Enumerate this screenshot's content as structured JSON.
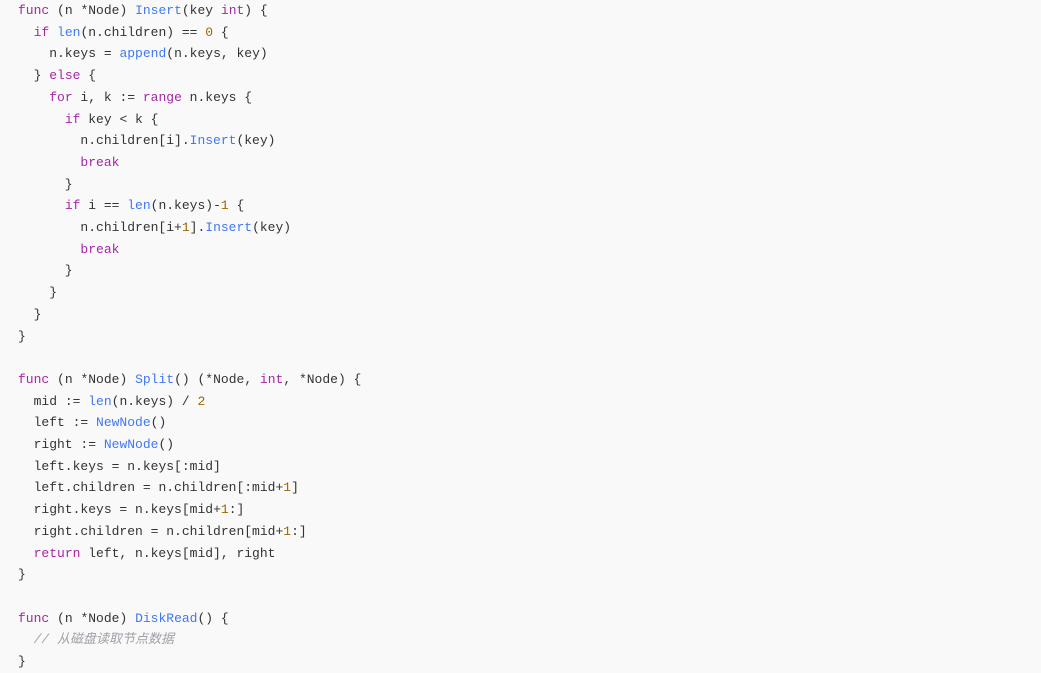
{
  "code": {
    "lines": [
      [
        {
          "t": "func",
          "c": "kw"
        },
        {
          "t": " (n ",
          "c": "ident"
        },
        {
          "t": "*",
          "c": "op"
        },
        {
          "t": "Node) ",
          "c": "ident"
        },
        {
          "t": "Insert",
          "c": "fn"
        },
        {
          "t": "(key ",
          "c": "ident"
        },
        {
          "t": "int",
          "c": "type"
        },
        {
          "t": ") {",
          "c": "punct"
        }
      ],
      [
        {
          "t": "  ",
          "c": "ident"
        },
        {
          "t": "if",
          "c": "kw"
        },
        {
          "t": " ",
          "c": "ident"
        },
        {
          "t": "len",
          "c": "call"
        },
        {
          "t": "(n.children) ",
          "c": "ident"
        },
        {
          "t": "==",
          "c": "op"
        },
        {
          "t": " ",
          "c": "ident"
        },
        {
          "t": "0",
          "c": "num"
        },
        {
          "t": " {",
          "c": "punct"
        }
      ],
      [
        {
          "t": "    n.keys ",
          "c": "ident"
        },
        {
          "t": "=",
          "c": "op"
        },
        {
          "t": " ",
          "c": "ident"
        },
        {
          "t": "append",
          "c": "call"
        },
        {
          "t": "(n.keys, key)",
          "c": "ident"
        }
      ],
      [
        {
          "t": "  } ",
          "c": "punct"
        },
        {
          "t": "else",
          "c": "kw"
        },
        {
          "t": " {",
          "c": "punct"
        }
      ],
      [
        {
          "t": "    ",
          "c": "ident"
        },
        {
          "t": "for",
          "c": "kw"
        },
        {
          "t": " i, k ",
          "c": "ident"
        },
        {
          "t": ":=",
          "c": "op"
        },
        {
          "t": " ",
          "c": "ident"
        },
        {
          "t": "range",
          "c": "kw"
        },
        {
          "t": " n.keys {",
          "c": "ident"
        }
      ],
      [
        {
          "t": "      ",
          "c": "ident"
        },
        {
          "t": "if",
          "c": "kw"
        },
        {
          "t": " key ",
          "c": "ident"
        },
        {
          "t": "<",
          "c": "op"
        },
        {
          "t": " k {",
          "c": "ident"
        }
      ],
      [
        {
          "t": "        n.children[i].",
          "c": "ident"
        },
        {
          "t": "Insert",
          "c": "call"
        },
        {
          "t": "(key)",
          "c": "ident"
        }
      ],
      [
        {
          "t": "        ",
          "c": "ident"
        },
        {
          "t": "break",
          "c": "kw"
        }
      ],
      [
        {
          "t": "      }",
          "c": "punct"
        }
      ],
      [
        {
          "t": "      ",
          "c": "ident"
        },
        {
          "t": "if",
          "c": "kw"
        },
        {
          "t": " i ",
          "c": "ident"
        },
        {
          "t": "==",
          "c": "op"
        },
        {
          "t": " ",
          "c": "ident"
        },
        {
          "t": "len",
          "c": "call"
        },
        {
          "t": "(n.keys)",
          "c": "ident"
        },
        {
          "t": "-",
          "c": "op"
        },
        {
          "t": "1",
          "c": "num"
        },
        {
          "t": " {",
          "c": "punct"
        }
      ],
      [
        {
          "t": "        n.children[i",
          "c": "ident"
        },
        {
          "t": "+",
          "c": "op"
        },
        {
          "t": "1",
          "c": "num"
        },
        {
          "t": "].",
          "c": "ident"
        },
        {
          "t": "Insert",
          "c": "call"
        },
        {
          "t": "(key)",
          "c": "ident"
        }
      ],
      [
        {
          "t": "        ",
          "c": "ident"
        },
        {
          "t": "break",
          "c": "kw"
        }
      ],
      [
        {
          "t": "      }",
          "c": "punct"
        }
      ],
      [
        {
          "t": "    }",
          "c": "punct"
        }
      ],
      [
        {
          "t": "  }",
          "c": "punct"
        }
      ],
      [
        {
          "t": "}",
          "c": "punct"
        }
      ],
      [
        {
          "t": "",
          "c": "ident"
        }
      ],
      [
        {
          "t": "func",
          "c": "kw"
        },
        {
          "t": " (n ",
          "c": "ident"
        },
        {
          "t": "*",
          "c": "op"
        },
        {
          "t": "Node) ",
          "c": "ident"
        },
        {
          "t": "Split",
          "c": "fn"
        },
        {
          "t": "() (",
          "c": "punct"
        },
        {
          "t": "*",
          "c": "op"
        },
        {
          "t": "Node, ",
          "c": "ident"
        },
        {
          "t": "int",
          "c": "type"
        },
        {
          "t": ", ",
          "c": "punct"
        },
        {
          "t": "*",
          "c": "op"
        },
        {
          "t": "Node) {",
          "c": "ident"
        }
      ],
      [
        {
          "t": "  mid ",
          "c": "ident"
        },
        {
          "t": ":=",
          "c": "op"
        },
        {
          "t": " ",
          "c": "ident"
        },
        {
          "t": "len",
          "c": "call"
        },
        {
          "t": "(n.keys) ",
          "c": "ident"
        },
        {
          "t": "/",
          "c": "op"
        },
        {
          "t": " ",
          "c": "ident"
        },
        {
          "t": "2",
          "c": "num"
        }
      ],
      [
        {
          "t": "  left ",
          "c": "ident"
        },
        {
          "t": ":=",
          "c": "op"
        },
        {
          "t": " ",
          "c": "ident"
        },
        {
          "t": "NewNode",
          "c": "call"
        },
        {
          "t": "()",
          "c": "punct"
        }
      ],
      [
        {
          "t": "  right ",
          "c": "ident"
        },
        {
          "t": ":=",
          "c": "op"
        },
        {
          "t": " ",
          "c": "ident"
        },
        {
          "t": "NewNode",
          "c": "call"
        },
        {
          "t": "()",
          "c": "punct"
        }
      ],
      [
        {
          "t": "  left.keys ",
          "c": "ident"
        },
        {
          "t": "=",
          "c": "op"
        },
        {
          "t": " n.keys[:mid]",
          "c": "ident"
        }
      ],
      [
        {
          "t": "  left.children ",
          "c": "ident"
        },
        {
          "t": "=",
          "c": "op"
        },
        {
          "t": " n.children[:mid",
          "c": "ident"
        },
        {
          "t": "+",
          "c": "op"
        },
        {
          "t": "1",
          "c": "num"
        },
        {
          "t": "]",
          "c": "ident"
        }
      ],
      [
        {
          "t": "  right.keys ",
          "c": "ident"
        },
        {
          "t": "=",
          "c": "op"
        },
        {
          "t": " n.keys[mid",
          "c": "ident"
        },
        {
          "t": "+",
          "c": "op"
        },
        {
          "t": "1",
          "c": "num"
        },
        {
          "t": ":]",
          "c": "ident"
        }
      ],
      [
        {
          "t": "  right.children ",
          "c": "ident"
        },
        {
          "t": "=",
          "c": "op"
        },
        {
          "t": " n.children[mid",
          "c": "ident"
        },
        {
          "t": "+",
          "c": "op"
        },
        {
          "t": "1",
          "c": "num"
        },
        {
          "t": ":]",
          "c": "ident"
        }
      ],
      [
        {
          "t": "  ",
          "c": "ident"
        },
        {
          "t": "return",
          "c": "kw"
        },
        {
          "t": " left, n.keys[mid], right",
          "c": "ident"
        }
      ],
      [
        {
          "t": "}",
          "c": "punct"
        }
      ],
      [
        {
          "t": "",
          "c": "ident"
        }
      ],
      [
        {
          "t": "func",
          "c": "kw"
        },
        {
          "t": " (n ",
          "c": "ident"
        },
        {
          "t": "*",
          "c": "op"
        },
        {
          "t": "Node) ",
          "c": "ident"
        },
        {
          "t": "DiskRead",
          "c": "fn"
        },
        {
          "t": "() {",
          "c": "punct"
        }
      ],
      [
        {
          "t": "  // 从磁盘读取节点数据",
          "c": "cmt"
        }
      ],
      [
        {
          "t": "}",
          "c": "punct"
        }
      ]
    ]
  }
}
